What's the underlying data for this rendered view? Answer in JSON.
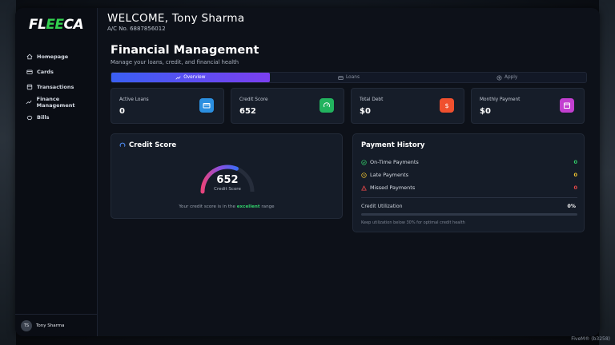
{
  "brand": {
    "logo_left": "FL",
    "logo_mid": "EE",
    "logo_right": "CA"
  },
  "sidebar": {
    "items": [
      {
        "label": "Homepage",
        "icon": "home-icon"
      },
      {
        "label": "Cards",
        "icon": "card-icon"
      },
      {
        "label": "Transactions",
        "icon": "receipt-icon"
      },
      {
        "label": "Finance Management",
        "icon": "trend-icon"
      },
      {
        "label": "Bills",
        "icon": "piggy-icon"
      }
    ],
    "user": {
      "initials": "TS",
      "name": "Tony Sharma"
    }
  },
  "header": {
    "welcome": "WELCOME, Tony Sharma",
    "account": "A/C No. 6887856012"
  },
  "page": {
    "title": "Financial Management",
    "subtitle": "Manage your loans, credit, and financial health"
  },
  "tabs": [
    {
      "label": "Overview",
      "icon": "trend-icon",
      "active": true
    },
    {
      "label": "Loans",
      "icon": "card-icon",
      "active": false
    },
    {
      "label": "Apply",
      "icon": "plus-circle-icon",
      "active": false
    }
  ],
  "stats": [
    {
      "label": "Active Loans",
      "value": "0",
      "icon": "card-icon",
      "color": "#2b8fe0"
    },
    {
      "label": "Credit Score",
      "value": "652",
      "icon": "gauge-icon",
      "color": "#22b35e"
    },
    {
      "label": "Total Debt",
      "value": "$0",
      "icon": "dollar-icon",
      "color": "#f0502e"
    },
    {
      "label": "Monthly Payment",
      "value": "$0",
      "icon": "calendar-icon",
      "color": "#c23fd0"
    }
  ],
  "credit_score": {
    "title": "Credit Score",
    "value": "652",
    "label": "Credit Score",
    "note_prefix": "Your credit score is in the",
    "note_highlight": "excellent",
    "note_suffix": "range",
    "gauge_fraction": 0.62
  },
  "payment_history": {
    "title": "Payment History",
    "rows": [
      {
        "label": "On-Time Payments",
        "value": "0",
        "icon": "check-circle-icon",
        "color": "#31d06a"
      },
      {
        "label": "Late Payments",
        "value": "0",
        "icon": "clock-icon",
        "color": "#f2c531"
      },
      {
        "label": "Missed Payments",
        "value": "0",
        "icon": "warning-icon",
        "color": "#ef4a4a"
      }
    ],
    "utilization_label": "Credit Utilization",
    "utilization_value": "0%",
    "utilization_fraction": 0,
    "utilization_note": "Keep utilization below 30% for optimal credit health"
  },
  "footer": {
    "tag": "FiveM® (b3258)"
  }
}
